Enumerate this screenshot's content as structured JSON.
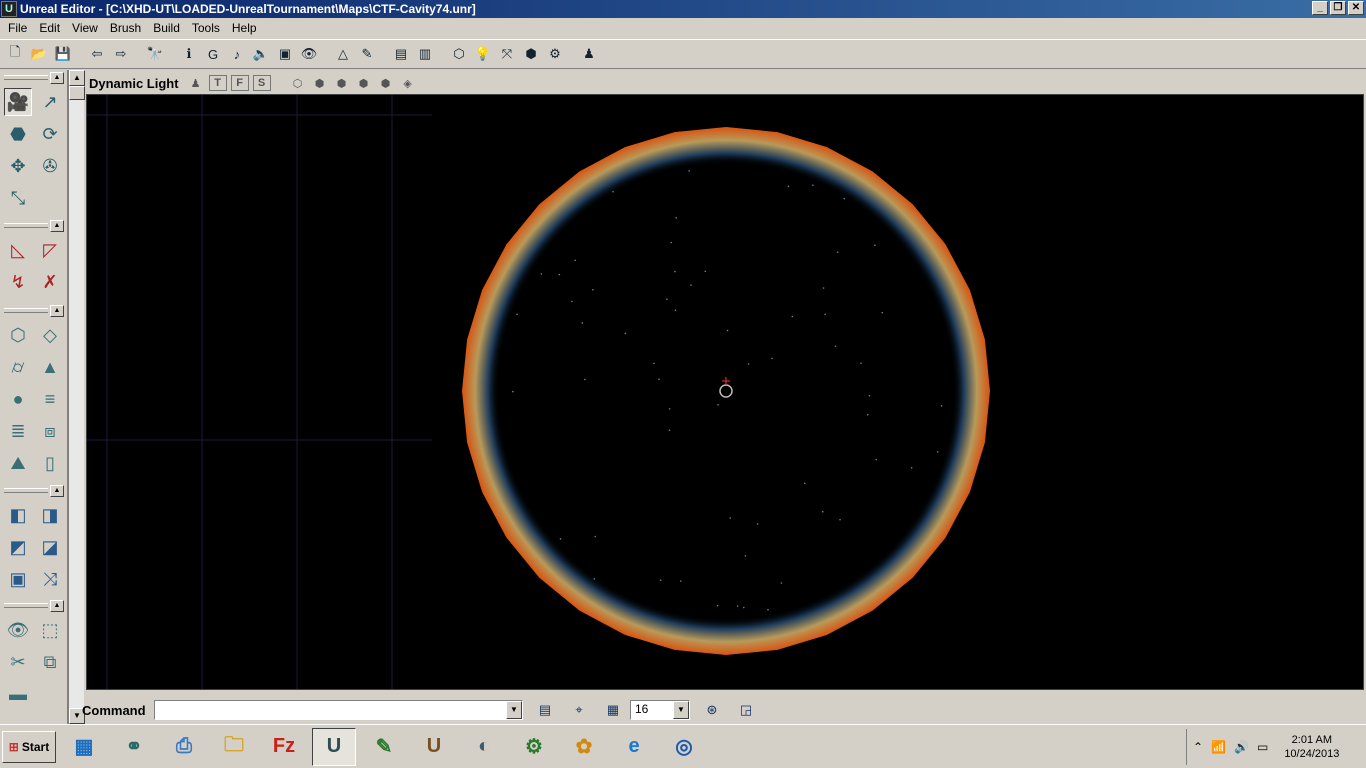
{
  "window": {
    "title": "Unreal Editor - [C:\\XHD-UT\\LOADED-UnrealTournament\\Maps\\CTF-Cavity74.unr]",
    "app_icon": "unreal-logo-icon",
    "minimize": "_",
    "restore": "❐",
    "close": "✕"
  },
  "menu": [
    "File",
    "Edit",
    "View",
    "Brush",
    "Build",
    "Tools",
    "Help"
  ],
  "toolbar": {
    "icons": [
      {
        "name": "new-map-icon",
        "glyph": "🗋"
      },
      {
        "name": "open-map-icon",
        "glyph": "📂"
      },
      {
        "name": "save-map-icon",
        "glyph": "💾"
      },
      {
        "name": "undo-icon",
        "glyph": "⇦"
      },
      {
        "name": "redo-icon",
        "glyph": "⇨"
      },
      {
        "name": "search-actors-icon",
        "glyph": "🔭"
      },
      {
        "name": "actor-properties-icon",
        "glyph": "ℹ"
      },
      {
        "name": "group-browser-icon",
        "glyph": "G"
      },
      {
        "name": "music-browser-icon",
        "glyph": "♪"
      },
      {
        "name": "sound-browser-icon",
        "glyph": "🔈"
      },
      {
        "name": "texture-browser-icon",
        "glyph": "▣"
      },
      {
        "name": "mesh-browser-icon",
        "glyph": "👁"
      },
      {
        "name": "2d-shape-editor-icon",
        "glyph": "△"
      },
      {
        "name": "unrealscript-editor-icon",
        "glyph": "✎"
      },
      {
        "name": "build-geometry-icon",
        "glyph": "▤"
      },
      {
        "name": "build-bsp-icon",
        "glyph": "▥"
      },
      {
        "name": "rebuild-geometry-icon",
        "glyph": "⬡"
      },
      {
        "name": "build-lighting-icon",
        "glyph": "💡"
      },
      {
        "name": "build-paths-icon",
        "glyph": "⤧"
      },
      {
        "name": "build-all-icon",
        "glyph": "⬢"
      },
      {
        "name": "build-options-icon",
        "glyph": "⚙"
      },
      {
        "name": "play-level-icon",
        "glyph": "♟"
      }
    ]
  },
  "palette": {
    "collapse_glyph": "▲",
    "scroll_up": "▲",
    "scroll_down": "▼",
    "tools": [
      {
        "name": "camera-move-tool-icon",
        "glyph": "🎥"
      },
      {
        "name": "vertex-edit-tool-icon",
        "glyph": "↗"
      },
      {
        "name": "brush-clip-tool-icon",
        "glyph": "⬣"
      },
      {
        "name": "rotate-tool-icon",
        "glyph": "⟳"
      },
      {
        "name": "pan-texture-tool-icon",
        "glyph": "✥"
      },
      {
        "name": "rotate-texture-tool-icon",
        "glyph": "✇"
      },
      {
        "name": "scale-tool-icon",
        "glyph": "⤡"
      },
      {
        "name": "clip-brush-icon",
        "glyph": "◺"
      },
      {
        "name": "clip-split-icon",
        "glyph": "◸"
      },
      {
        "name": "clip-flip-icon",
        "glyph": "↯"
      },
      {
        "name": "clip-delete-icon",
        "glyph": "✗"
      },
      {
        "name": "cube-builder-icon",
        "glyph": "⬡"
      },
      {
        "name": "sheet-builder-icon",
        "glyph": "◇"
      },
      {
        "name": "cylinder-builder-icon",
        "glyph": "⌭"
      },
      {
        "name": "cone-builder-icon",
        "glyph": "▲"
      },
      {
        "name": "sphere-builder-icon",
        "glyph": "●"
      },
      {
        "name": "staircase-builder-icon",
        "glyph": "≡"
      },
      {
        "name": "curved-stair-builder-icon",
        "glyph": "≣"
      },
      {
        "name": "spiral-stair-builder-icon",
        "glyph": "⧈"
      },
      {
        "name": "terrain-builder-icon",
        "glyph": "⛰"
      },
      {
        "name": "volumetric-builder-icon",
        "glyph": "▯"
      },
      {
        "name": "add-brush-icon",
        "glyph": "◧"
      },
      {
        "name": "subtract-brush-icon",
        "glyph": "◨"
      },
      {
        "name": "intersect-brush-icon",
        "glyph": "◩"
      },
      {
        "name": "deintersect-brush-icon",
        "glyph": "◪"
      },
      {
        "name": "add-special-brush-icon",
        "glyph": "▣"
      },
      {
        "name": "add-mover-icon",
        "glyph": "⤨"
      },
      {
        "name": "show-selected-icon",
        "glyph": "👁"
      },
      {
        "name": "hide-selected-icon",
        "glyph": "⬚"
      },
      {
        "name": "hide-invert-icon",
        "glyph": "✂"
      },
      {
        "name": "select-all-icon",
        "glyph": "⧉"
      },
      {
        "name": "misc-tool-icon",
        "glyph": "▬"
      }
    ]
  },
  "viewport": {
    "title": "Dynamic Light",
    "mode_icons": [
      {
        "name": "lock-view-icon",
        "glyph": "♟"
      },
      {
        "name": "top-view-icon",
        "glyph": "T"
      },
      {
        "name": "front-view-icon",
        "glyph": "F"
      },
      {
        "name": "side-view-icon",
        "glyph": "S"
      },
      {
        "name": "wireframe-mode-icon",
        "glyph": "⬡"
      },
      {
        "name": "zone-mode-icon",
        "glyph": "⬢"
      },
      {
        "name": "texture-usage-mode-icon",
        "glyph": "⬢"
      },
      {
        "name": "bsp-cuts-mode-icon",
        "glyph": "⬢"
      },
      {
        "name": "textured-mode-icon",
        "glyph": "⬢"
      },
      {
        "name": "lighting-mode-icon",
        "glyph": "◈"
      }
    ],
    "colors": {
      "background": "#000000",
      "ring_outer": "#d9520f",
      "ring_mid": "#b89a5a",
      "ring_inner": "#1c3a5a",
      "grid": "#1a1a3a"
    }
  },
  "commandbar": {
    "label": "Command",
    "input_value": "",
    "dropdown_glyph": "▼",
    "log_icon": "log-window-icon",
    "snap_icon": "snap-vertex-icon",
    "grid_icon": "grid-toggle-icon",
    "grid_size": "16",
    "rotation_snap_icon": "rotation-snap-icon",
    "maximize_viewport_icon": "maximize-viewport-icon"
  },
  "taskbar": {
    "start_label": "Start",
    "apps": [
      {
        "name": "taskbar-app-windows-icon",
        "glyph": "▦"
      },
      {
        "name": "taskbar-app-network-icon",
        "glyph": "⚭"
      },
      {
        "name": "taskbar-app-scanner-icon",
        "glyph": "⎙"
      },
      {
        "name": "taskbar-app-explorer-icon",
        "glyph": "🗀"
      },
      {
        "name": "taskbar-app-filezilla-icon",
        "glyph": "Fz"
      },
      {
        "name": "taskbar-app-unrealed-icon",
        "glyph": "U"
      },
      {
        "name": "taskbar-app-notepad-icon",
        "glyph": "✎"
      },
      {
        "name": "taskbar-app-unreal-icon",
        "glyph": "U"
      },
      {
        "name": "taskbar-app-audio-icon",
        "glyph": "◐"
      },
      {
        "name": "taskbar-app-settings-icon",
        "glyph": "⚙"
      },
      {
        "name": "taskbar-app-fruityloops-icon",
        "glyph": "✿"
      },
      {
        "name": "taskbar-app-ie-icon",
        "glyph": "e"
      },
      {
        "name": "taskbar-app-planet-icon",
        "glyph": "◎"
      }
    ],
    "tray": {
      "expand": "⌃",
      "signal": "📶",
      "volume": "🔊",
      "monitor": "▭"
    },
    "time": "2:01 AM",
    "date": "10/24/2013"
  }
}
